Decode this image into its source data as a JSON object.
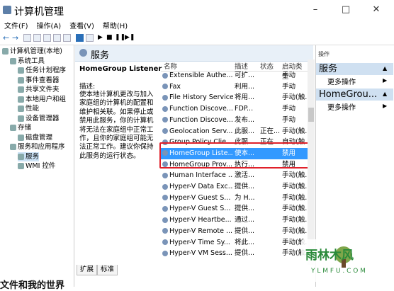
{
  "window": {
    "title": "计算机管理",
    "min": "–",
    "max": "□",
    "close": "✕"
  },
  "menu": [
    "文件(F)",
    "操作(A)",
    "查看(V)",
    "帮助(H)"
  ],
  "tree": [
    {
      "label": "计算机管理(本地)",
      "indent": 0
    },
    {
      "label": "系统工具",
      "indent": 1
    },
    {
      "label": "任务计划程序",
      "indent": 2
    },
    {
      "label": "事件查看器",
      "indent": 2
    },
    {
      "label": "共享文件夹",
      "indent": 2
    },
    {
      "label": "本地用户和组",
      "indent": 2
    },
    {
      "label": "性能",
      "indent": 2
    },
    {
      "label": "设备管理器",
      "indent": 2
    },
    {
      "label": "存储",
      "indent": 1
    },
    {
      "label": "磁盘管理",
      "indent": 2
    },
    {
      "label": "服务和应用程序",
      "indent": 1
    },
    {
      "label": "服务",
      "indent": 2,
      "selected": true
    },
    {
      "label": "WMI 控件",
      "indent": 2
    }
  ],
  "services_title": "服务",
  "selected_service": "HomeGroup Listener",
  "desc_label": "描述:",
  "desc_text": "使本地计算机更改与加入家庭组的计算机的配置和维护相关联。如果停止或禁用此服务，你的计算机将无法在家庭组中正常工作，且你的家庭组可能无法正常工作。建议你保持此服务的运行状态。",
  "columns": [
    "名称",
    "描述",
    "状态",
    "启动类型"
  ],
  "rows": [
    {
      "name": "Extensible Authe...",
      "desc": "可扩...",
      "status": "",
      "start": "手动"
    },
    {
      "name": "Fax",
      "desc": "利用...",
      "status": "",
      "start": "手动"
    },
    {
      "name": "File History Service",
      "desc": "将用...",
      "status": "",
      "start": "手动(触..."
    },
    {
      "name": "Function Discove...",
      "desc": "FDP...",
      "status": "",
      "start": "手动"
    },
    {
      "name": "Function Discove...",
      "desc": "发布...",
      "status": "",
      "start": "手动"
    },
    {
      "name": "Geolocation Serv...",
      "desc": "此服...",
      "status": "正在...",
      "start": "手动(触..."
    },
    {
      "name": "Group Policy Clie...",
      "desc": "此服...",
      "status": "正在...",
      "start": "自动(触..."
    },
    {
      "name": "HomeGroup Liste...",
      "desc": "使本...",
      "status": "",
      "start": "禁用",
      "selected": true
    },
    {
      "name": "HomeGroup Prov...",
      "desc": "执行...",
      "status": "",
      "start": "禁用"
    },
    {
      "name": "Human Interface ...",
      "desc": "激活...",
      "status": "",
      "start": "手动(触..."
    },
    {
      "name": "Hyper-V Data Exc...",
      "desc": "提供...",
      "status": "",
      "start": "手动(触..."
    },
    {
      "name": "Hyper-V Guest S...",
      "desc": "为 H...",
      "status": "",
      "start": "手动(触..."
    },
    {
      "name": "Hyper-V Guest S...",
      "desc": "提供...",
      "status": "",
      "start": "手动(触..."
    },
    {
      "name": "Hyper-V Heartbe...",
      "desc": "通过...",
      "status": "",
      "start": "手动(触..."
    },
    {
      "name": "Hyper-V Remote ...",
      "desc": "提供...",
      "status": "",
      "start": "手动(触..."
    },
    {
      "name": "Hyper-V Time Sy...",
      "desc": "将此...",
      "status": "",
      "start": "手动(触..."
    },
    {
      "name": "Hyper-V VM Sess...",
      "desc": "提供...",
      "status": "",
      "start": "手动(触..."
    }
  ],
  "tabs": [
    "扩展",
    "标准"
  ],
  "actions": {
    "label": "操作",
    "section1": "服务",
    "more1": "更多操作",
    "section2": "HomeGrou...",
    "more2": "更多操作"
  },
  "watermark": {
    "brand": "雨林木风",
    "url": "Y L M F U . C O M"
  },
  "bottom_text": "文件和我的世界"
}
